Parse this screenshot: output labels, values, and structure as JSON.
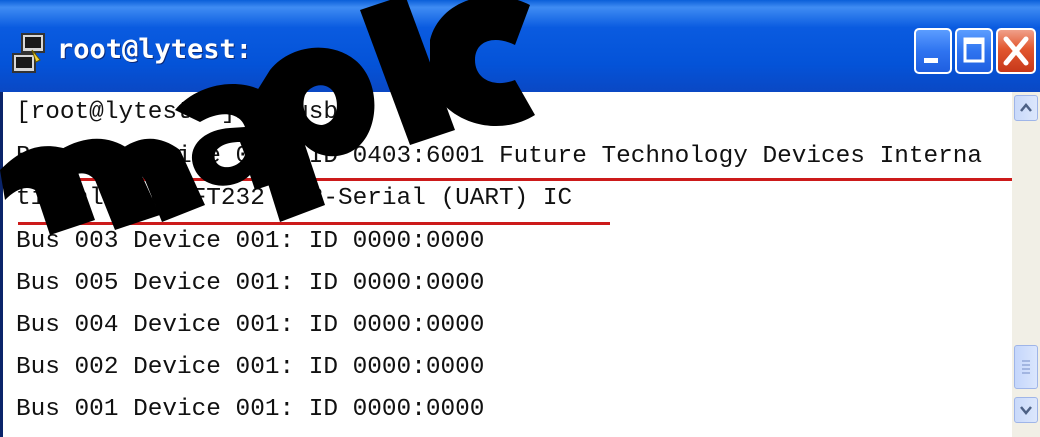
{
  "window": {
    "title": "root@lytest:",
    "colors": {
      "titlebar": "#0453d8",
      "close_button": "#e2572f",
      "highlight_underline": "#cc1a1a",
      "text": "#111111"
    }
  },
  "titlebar": {
    "icons": [
      "putty-icon"
    ],
    "buttons": [
      "minimize-button",
      "maximize-button",
      "close-button"
    ]
  },
  "terminal": {
    "lines": [
      "[root@lytest ~]# lsusb",
      "Bus 003 Device 002: ID 0403:6001 Future Technology Devices Interna",
      "tional, Ltd FT232 USB-Serial (UART) IC",
      "Bus 003 Device 001: ID 0000:0000",
      "Bus 005 Device 001: ID 0000:0000",
      "Bus 004 Device 001: ID 0000:0000",
      "Bus 002 Device 001: ID 0000:0000",
      "Bus 001 Device 001: ID 0000:0000"
    ]
  },
  "scrollbar": {
    "icons": [
      "scroll-up-arrow-icon",
      "scroll-down-arrow-icon"
    ]
  },
  "watermark": {
    "text": "maplc"
  }
}
